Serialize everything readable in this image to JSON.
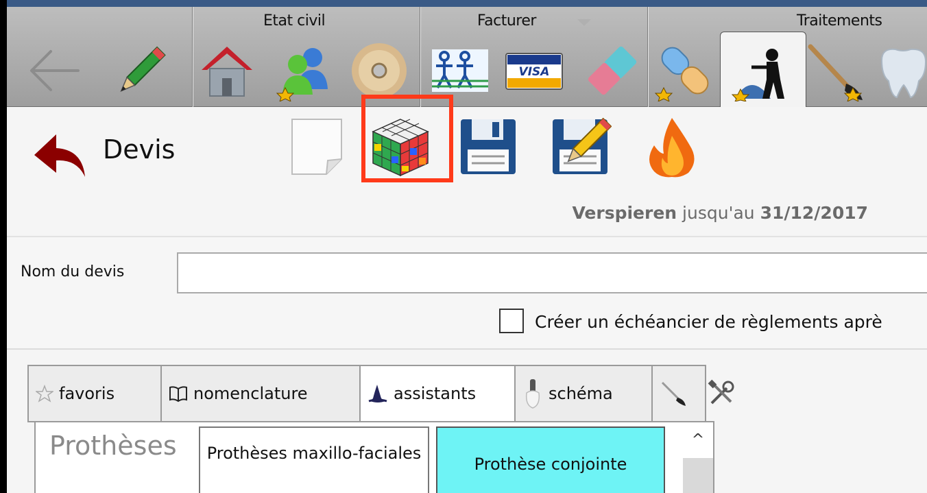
{
  "toolbar": {
    "groups": [
      "Etat civil",
      "Facturer",
      "Traitements"
    ],
    "icons": [
      "back-arrow-icon",
      "pencil-icon",
      "house-icon",
      "users-icon",
      "disc-icon",
      "social-security-icon",
      "visa-card-icon",
      "eraser-icon",
      "pill-icon",
      "worker-icon",
      "brush-icon",
      "tooth-icon"
    ]
  },
  "header": {
    "title": "Devis",
    "insurer_name": "Verspieren",
    "insurer_until": "jusqu'au",
    "insurer_date": "31/12/2017"
  },
  "form": {
    "name_label": "Nom du devis",
    "name_value": "",
    "schedule_checkbox_label": "Créer un échéancier de règlements aprè",
    "schedule_checked": false
  },
  "tabs": {
    "items": [
      {
        "label": "favoris",
        "icon": "star-icon"
      },
      {
        "label": "nomenclature",
        "icon": "book-icon"
      },
      {
        "label": "assistants",
        "icon": "wizard-hat-icon"
      },
      {
        "label": "schéma",
        "icon": "tooth-icon"
      },
      {
        "label": "",
        "icon": "brush-icon"
      }
    ],
    "selected": "assistants"
  },
  "assistants": {
    "category": "Prothèses",
    "buttons": [
      "Prothèses maxillo-faciales",
      "Prothèse conjointe"
    ]
  },
  "colors": {
    "highlight": "#ff3a1a",
    "selected_button": "#6ef3f5",
    "back_arrow": "#8b0000"
  }
}
